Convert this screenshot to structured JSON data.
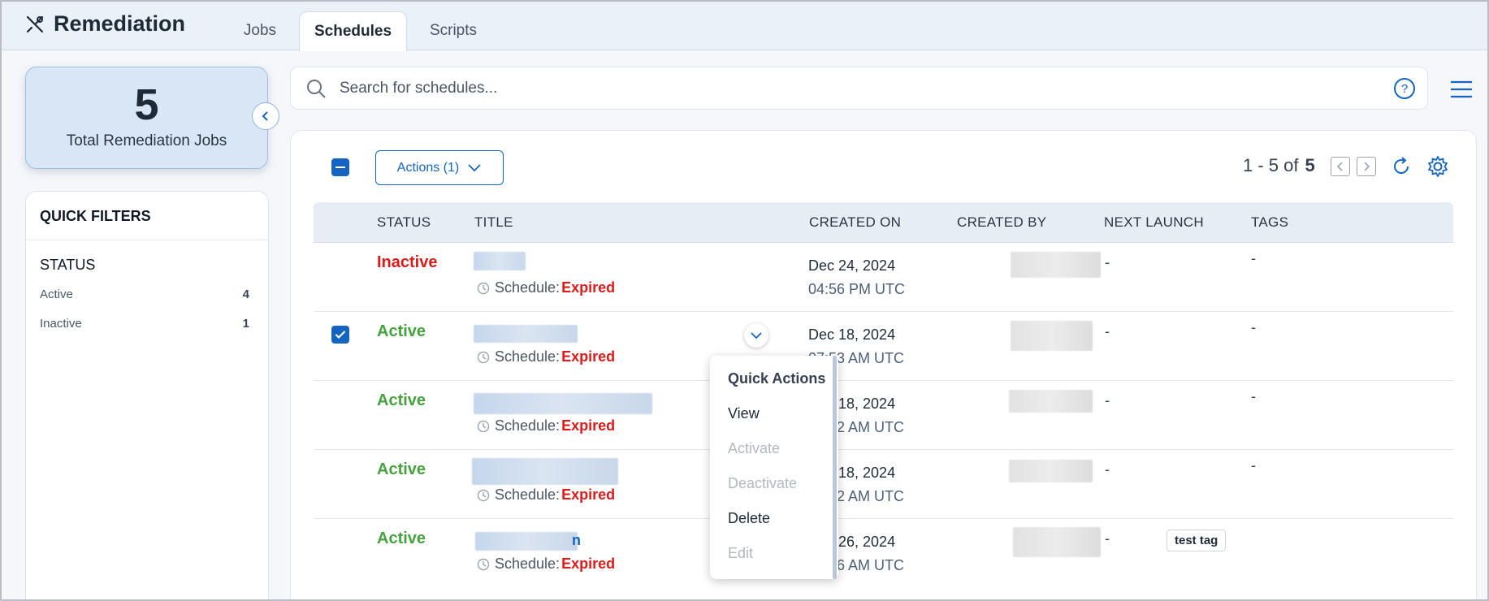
{
  "app": {
    "title": "Remediation"
  },
  "tabs": [
    {
      "label": "Jobs",
      "active": false
    },
    {
      "label": "Schedules",
      "active": true
    },
    {
      "label": "Scripts",
      "active": false
    }
  ],
  "summary": {
    "total": "5",
    "label": "Total Remediation Jobs"
  },
  "quick_filters": {
    "title": "QUICK FILTERS",
    "section": "STATUS",
    "items": [
      {
        "label": "Active",
        "count": "4"
      },
      {
        "label": "Inactive",
        "count": "1"
      }
    ]
  },
  "search": {
    "placeholder": "Search for schedules...",
    "value": ""
  },
  "toolbar": {
    "actions_label": "Actions (1)",
    "pager_range": "1 - 5 of",
    "pager_total": "5"
  },
  "table": {
    "columns": [
      "STATUS",
      "TITLE",
      "CREATED ON",
      "CREATED BY",
      "NEXT LAUNCH",
      "TAGS"
    ],
    "schedule_prefix": "Schedule:",
    "rows": [
      {
        "status": "Inactive",
        "schedule": "Expired",
        "created_date": "Dec 24, 2024",
        "created_time": "04:56 PM UTC",
        "next_launch": "-",
        "tags": "-",
        "checked": false
      },
      {
        "status": "Active",
        "schedule": "Expired",
        "created_date": "Dec 18, 2024",
        "created_time": "07:53 AM UTC",
        "next_launch": "-",
        "tags": "-",
        "checked": true
      },
      {
        "status": "Active",
        "schedule": "Expired",
        "created_date": "Dec 18, 2024",
        "created_time": "07:52 AM UTC",
        "next_launch": "-",
        "tags": "-",
        "checked": false
      },
      {
        "status": "Active",
        "schedule": "Expired",
        "created_date": "Dec 18, 2024",
        "created_time": "07:52 AM UTC",
        "next_launch": "-",
        "tags": "-",
        "checked": false
      },
      {
        "status": "Active",
        "schedule": "Expired",
        "created_date": "Nov 26, 2024",
        "created_time": "08:06 AM UTC",
        "next_launch": "-",
        "tags": "test tag",
        "checked": false,
        "title_tail": "n"
      }
    ]
  },
  "quick_actions": {
    "title": "Quick Actions",
    "items": [
      {
        "label": "View",
        "enabled": true
      },
      {
        "label": "Activate",
        "enabled": false
      },
      {
        "label": "Deactivate",
        "enabled": false
      },
      {
        "label": "Delete",
        "enabled": true
      },
      {
        "label": "Edit",
        "enabled": false
      }
    ]
  },
  "colors": {
    "accent": "#1565c0",
    "active": "#46a23f",
    "inactive": "#dc1b1b"
  },
  "icons": [
    "tools-icon",
    "search-icon",
    "help-icon",
    "hamburger-menu-icon",
    "chevron-left-icon",
    "chevron-down-icon",
    "chevron-right-icon",
    "refresh-icon",
    "gear-icon",
    "clock-icon",
    "checkbox-checked-icon"
  ]
}
